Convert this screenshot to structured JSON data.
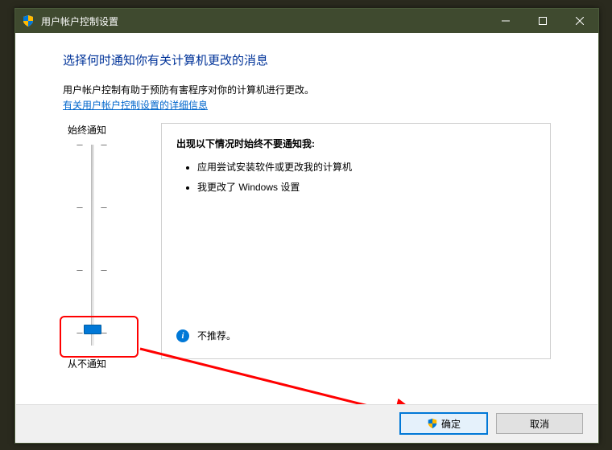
{
  "window": {
    "title": "用户帐户控制设置"
  },
  "heading": "选择何时通知你有关计算机更改的消息",
  "desc": "用户帐户控制有助于预防有害程序对你的计算机进行更改。",
  "link": "有关用户帐户控制设置的详细信息",
  "slider": {
    "topLabel": "始终通知",
    "bottomLabel": "从不通知"
  },
  "panel": {
    "title": "出现以下情况时始终不要通知我:",
    "items": [
      "应用尝试安装软件或更改我的计算机",
      "我更改了 Windows 设置"
    ],
    "notRecommended": "不推荐。"
  },
  "footer": {
    "ok": "确定",
    "cancel": "取消"
  }
}
